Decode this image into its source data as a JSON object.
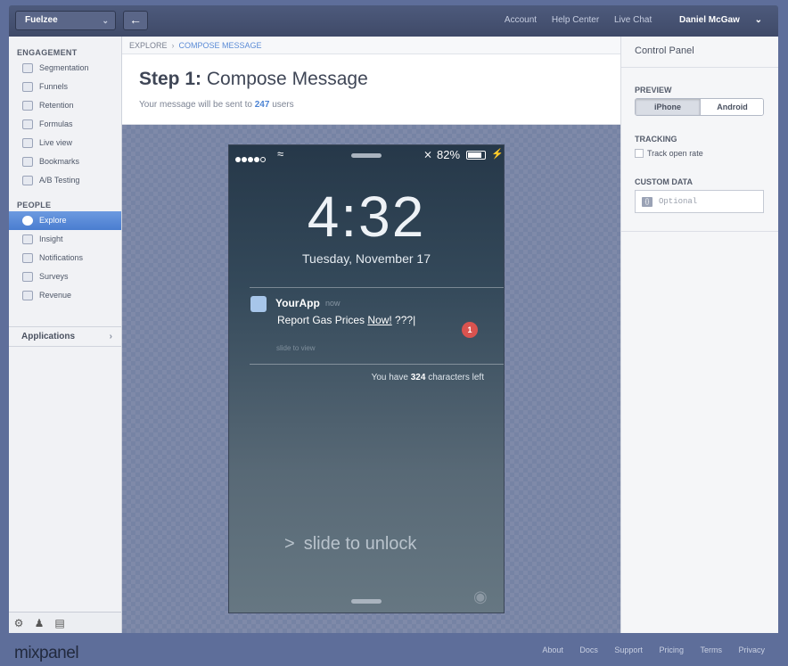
{
  "topbar": {
    "project": "Fuelzee",
    "back_icon": "arrow-left-icon",
    "links": [
      "Account",
      "Help Center",
      "Live Chat"
    ],
    "user": "Daniel McGaw"
  },
  "sidebar": {
    "engagement_title": "ENGAGEMENT",
    "engagement_items": [
      {
        "label": "Segmentation",
        "icon": "pie-chart-icon"
      },
      {
        "label": "Funnels",
        "icon": "funnel-icon"
      },
      {
        "label": "Retention",
        "icon": "retention-icon"
      },
      {
        "label": "Formulas",
        "icon": "formula-icon"
      },
      {
        "label": "Live view",
        "icon": "live-view-icon"
      },
      {
        "label": "Bookmarks",
        "icon": "bookmark-icon"
      },
      {
        "label": "A/B Testing",
        "icon": "ab-testing-icon"
      }
    ],
    "people_title": "PEOPLE",
    "people_items": [
      {
        "label": "Explore",
        "icon": "explore-icon",
        "active": true
      },
      {
        "label": "Insight",
        "icon": "insight-icon"
      },
      {
        "label": "Notifications",
        "icon": "notifications-icon"
      },
      {
        "label": "Surveys",
        "icon": "survey-icon"
      },
      {
        "label": "Revenue",
        "icon": "revenue-icon"
      }
    ],
    "applications": "Applications"
  },
  "breadcrumb": {
    "parent": "EXPLORE",
    "current": "COMPOSE MESSAGE"
  },
  "header": {
    "step": "Step 1:",
    "title": "Compose Message",
    "sub_prefix": "Your message will be sent to",
    "count": "247",
    "sub_suffix": "users"
  },
  "phone": {
    "battery": "82%",
    "time": "4:32",
    "date": "Tuesday, November 17",
    "app_name": "YourApp",
    "app_time": "now",
    "msg_plain": "Report Gas Prices ",
    "msg_underlined": "Now!",
    "msg_rest": " ???",
    "badge": "1",
    "slide_view": "slide to view",
    "chars_prefix": "You have",
    "chars_left": "324",
    "chars_suffix": "characters left",
    "unlock_arrow": ">",
    "unlock_text": "slide to unlock"
  },
  "control_panel": {
    "title": "Control Panel",
    "preview_title": "PREVIEW",
    "preview_options": [
      "iPhone",
      "Android"
    ],
    "preview_selected": "iPhone",
    "tracking_title": "TRACKING",
    "track_open_rate": "Track open rate",
    "custom_data_title": "CUSTOM DATA",
    "custom_data_placeholder": "Optional"
  },
  "footer": {
    "logo": "mixpanel",
    "links": [
      "About",
      "Docs",
      "Support",
      "Pricing",
      "Terms",
      "Privacy"
    ]
  }
}
